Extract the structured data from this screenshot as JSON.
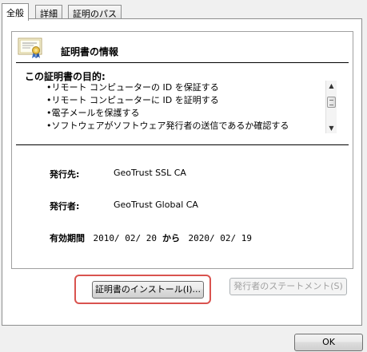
{
  "tabs": [
    {
      "label": "全般"
    },
    {
      "label": "詳細"
    },
    {
      "label": "証明のパス"
    }
  ],
  "cert_info": {
    "title": "証明書の情報",
    "purpose_heading": "この証明書の目的:",
    "purposes": [
      "•リモート コンピューターの ID を保証する",
      "•リモート コンピューターに ID を証明する",
      "•電子メールを保護する",
      "•ソフトウェアがソフトウェア発行者の送信であるか確認する"
    ],
    "issued_to_label": "発行先:",
    "issued_to_value": "GeoTrust SSL CA",
    "issued_by_label": "発行者:",
    "issued_by_value": "GeoTrust Global CA",
    "validity_label": "有効期間",
    "valid_from": "2010/ 02/ 20",
    "validity_to_label": "から",
    "valid_to": "2020/ 02/ 19"
  },
  "buttons": {
    "install": "証明書のインストール(I)...",
    "issuer_statement": "発行者のステートメント(S)",
    "ok": "OK"
  },
  "colors": {
    "highlight": "#d9534f"
  }
}
